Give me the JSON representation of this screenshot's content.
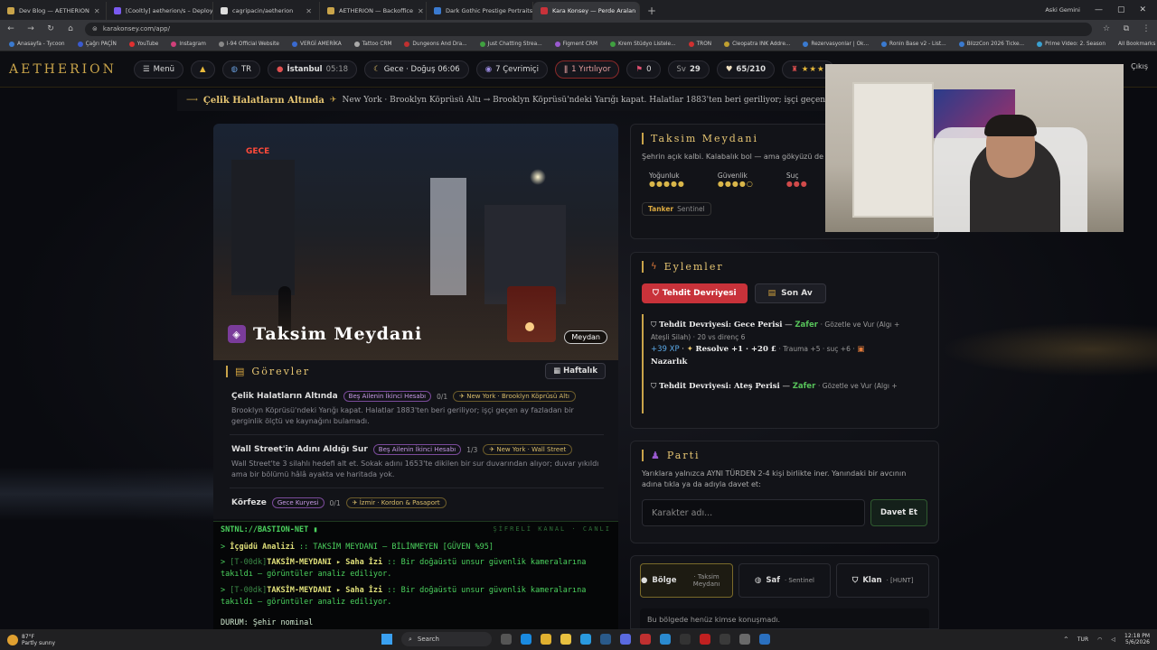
{
  "browser": {
    "tabs": [
      {
        "label": "Dev Blog — AETHERION",
        "color": "#c9a44a"
      },
      {
        "label": "[Cooltly] aetherion/s – Deploy",
        "color": "#7a5af0"
      },
      {
        "label": "cagripacin/aetherion",
        "color": "#dddddd"
      },
      {
        "label": "AETHERION — Backoffice",
        "color": "#c9a44a"
      },
      {
        "label": "Dark Gothic Prestige Portraits",
        "color": "#3a7ad0"
      },
      {
        "label": "Kara Konsey — Perde Aralan",
        "color": "#c8323a"
      }
    ],
    "new_tab": "+",
    "profile": "Aski Gemini",
    "url": "karakonsey.com/app/",
    "bookmarks": [
      {
        "label": "Anasayfa - Tycoon",
        "color": "#3a7ad0"
      },
      {
        "label": "Çağrı PAÇİN",
        "color": "#3a5ad0"
      },
      {
        "label": "YouTube",
        "color": "#e03030"
      },
      {
        "label": "Instagram",
        "color": "#d0407a"
      },
      {
        "label": "I-94 Official Website",
        "color": "#888888"
      },
      {
        "label": "VERGİ AMERİKA",
        "color": "#3a6ad0"
      },
      {
        "label": "Tattoo CRM",
        "color": "#aaaaaa"
      },
      {
        "label": "Dungeons And Dra...",
        "color": "#c03030"
      },
      {
        "label": "Just Chatting Strea...",
        "color": "#40a040"
      },
      {
        "label": "Figment CRM",
        "color": "#9a5ad0"
      },
      {
        "label": "Krem Stüdyo Listele...",
        "color": "#40a040"
      },
      {
        "label": "TRON",
        "color": "#d03030"
      },
      {
        "label": "Cleopatra INK Addre...",
        "color": "#c0a030"
      },
      {
        "label": "Rezervasyonlar | Ok...",
        "color": "#3a7ad0"
      },
      {
        "label": "Ronin Base v2 - List...",
        "color": "#3a7ad0"
      },
      {
        "label": "BlizzCon 2026 Ticke...",
        "color": "#3a7ad0"
      },
      {
        "label": "Prime Video: 2. Season",
        "color": "#3aa0d0"
      }
    ],
    "all_bookmarks": "All Bookmarks"
  },
  "header": {
    "logo": "AETHERION",
    "menu": "Menü",
    "lang": "TR",
    "city": "İstanbul",
    "time": "05:18",
    "phase": "Gece · Doğuş 06:06",
    "online": "7 Çevrimiçi",
    "torn": "1 Yırtılıyor",
    "flag_count": "0",
    "level_label": "Sv",
    "level": "29",
    "hp": "65/210",
    "stars": "★★★",
    "exit": "Çıkış"
  },
  "marquee": {
    "title": "Çelik Halatların Altında",
    "text": "New York · Brooklyn Köprüsü Altı → Brooklyn Köprüsü'ndeki Yarığı kapat. Halatlar 1883'ten beri geriliyor; işçi geçen ay fazladan bi"
  },
  "hero": {
    "title": "Taksim Meydani",
    "tag": "Meydan",
    "neon": "GECE"
  },
  "quests": {
    "title": "Görevler",
    "weekly": "Haftalık",
    "items": [
      {
        "name": "Çelik Halatların Altında",
        "badge": "Beş Ailenin İkinci Hesabı",
        "count": "0/1",
        "loc": "New York · Brooklyn Köprüsü Altı",
        "desc": "Brooklyn Köprüsü'ndeki Yarığı kapat. Halatlar 1883'ten beri geriliyor; işçi geçen ay fazladan bir gerginlik ölçtü ve kaynağını bulamadı."
      },
      {
        "name": "Wall Street'in Adını Aldığı Sur",
        "badge": "Beş Ailenin İkinci Hesabı",
        "count": "1/3",
        "loc": "New York · Wall Street",
        "desc": "Wall Street'te 3 silahlı hedefi alt et. Sokak adını 1653'te dikilen bir sur duvarından alıyor; duvar yıkıldı ama bir bölümü hâlâ ayakta ve haritada yok."
      },
      {
        "name": "Körfeze",
        "badge": "Gece Kuryesi",
        "count": "0/1",
        "loc": "İzmir · Kordon & Pasaport",
        "desc": ""
      }
    ]
  },
  "terminal": {
    "channel": "SNTNL://BASTION-NET ▮",
    "right": "ŞİFRELİ KANAL · CANLI",
    "line1_a": "İçgüdü Analizi",
    "line1_b": ":: TAKSİM MEYDANI — BİLİNMEYEN [GÜVEN %95]",
    "line2_a": "[T-00dk]",
    "line2_b": "TAKSİM-MEYDANI",
    "line2_c": "▸ Saha İzi",
    "line2_d": ":: Bir doğaüstü unsur güvenlik kameralarına takıldı — görüntüler analiz ediliyor.",
    "line3_a": "[T-00dk]",
    "line3_b": "TAKSİM-MEYDANI",
    "line3_c": "▸ Saha İzi",
    "line3_d": ":: Bir doğaüstü unsur güvenlik kameralarına takıldı — görüntüler analiz ediliyor.",
    "status": "DURUM: Şehir nominal"
  },
  "location": {
    "title": "Taksim Meydani",
    "desc": "Şehrin açık kalbi. Kalabalık bol — ama gökyüzü de",
    "stats": [
      {
        "label": "Yoğunluk",
        "value": "●●●●●"
      },
      {
        "label": "Güvenlik",
        "value": "●●●●○"
      },
      {
        "label": "Suç",
        "value": "●●●"
      }
    ],
    "role": "Tanker",
    "role_sub": "Sentinel"
  },
  "actions": {
    "title": "Eylemler",
    "primary": "Tehdit Devriyesi",
    "secondary": "Son Av",
    "log": [
      {
        "head": "Tehdit Devriyesi: Gece Perisi",
        "result": "Zafer",
        "meta": "· Gözetle ve Vur (Algı + Ateşli Silah) · 20 vs direnç 6",
        "xp": "+39 XP",
        "rewards": "Resolve +1 · +20 £",
        "trauma": "· Trauma +5 · suç +6 ·",
        "item": "Nazarlık"
      },
      {
        "head": "Tehdit Devriyesi: Ateş Perisi",
        "result": "Zafer",
        "meta": "· Gözetle ve Vur (Algı +"
      }
    ]
  },
  "party": {
    "title": "Parti",
    "desc": "Yarıklara yalnızca AYNI TÜRDEN 2-4 kişi birlikte iner. Yanındaki bir avcının adına tıkla ya da adıyla davet et:",
    "placeholder": "Karakter adı...",
    "invite": "Davet Et"
  },
  "chat": {
    "tabs": [
      {
        "label": "Bölge",
        "sub": "· Taksim Meydanı"
      },
      {
        "label": "Saf",
        "sub": "· Sentinel"
      },
      {
        "label": "Klan",
        "sub": "· [HUNT]"
      }
    ],
    "empty": "Bu bölgede henüz kimse konuşmadı."
  },
  "taskbar": {
    "temp": "87°F",
    "weather": "Partly sunny",
    "search": "Search",
    "lang": "TUR",
    "time": "12:18 PM",
    "date": "5/6/2026"
  }
}
